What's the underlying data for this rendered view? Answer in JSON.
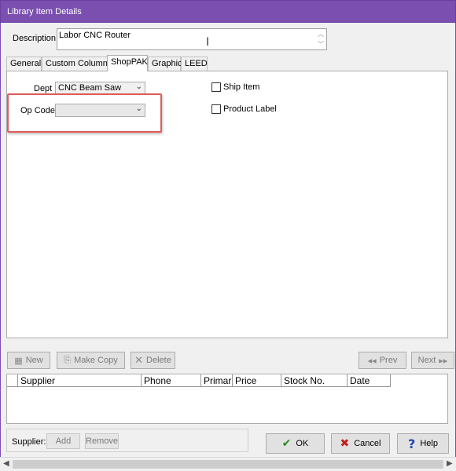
{
  "window": {
    "title": "Library Item Details"
  },
  "description": {
    "label": "Description",
    "value": "Labor CNC Router"
  },
  "tabs": [
    {
      "label": "General"
    },
    {
      "label": "Custom Columns"
    },
    {
      "label": "ShopPAK"
    },
    {
      "label": "Graphic"
    },
    {
      "label": "LEED"
    }
  ],
  "active_tab": "ShopPAK",
  "shoppak": {
    "dept_label": "Dept",
    "dept_value": "CNC Beam Saw",
    "opcode_label": "Op Code",
    "opcode_value": "",
    "ship_item_label": "Ship Item",
    "product_label_label": "Product Label"
  },
  "toolbar": {
    "new_label": "New",
    "make_copy_label": "Make Copy",
    "delete_label": "Delete",
    "prev_label": "Prev",
    "next_label": "Next"
  },
  "grid": {
    "columns": [
      "Supplier",
      "Phone",
      "Primar",
      "Price",
      "Stock No.",
      "Date"
    ]
  },
  "supplier_panel": {
    "label": "Supplier:",
    "add_label": "Add",
    "remove_label": "Remove"
  },
  "actions": {
    "ok_label": "OK",
    "cancel_label": "Cancel",
    "help_label": "Help"
  },
  "colors": {
    "titlebar": "#7b4fb0",
    "highlight": "#e05a5a",
    "ok_icon": "#2a8a2a",
    "cancel_icon": "#c02020",
    "help_icon": "#2040b0"
  }
}
